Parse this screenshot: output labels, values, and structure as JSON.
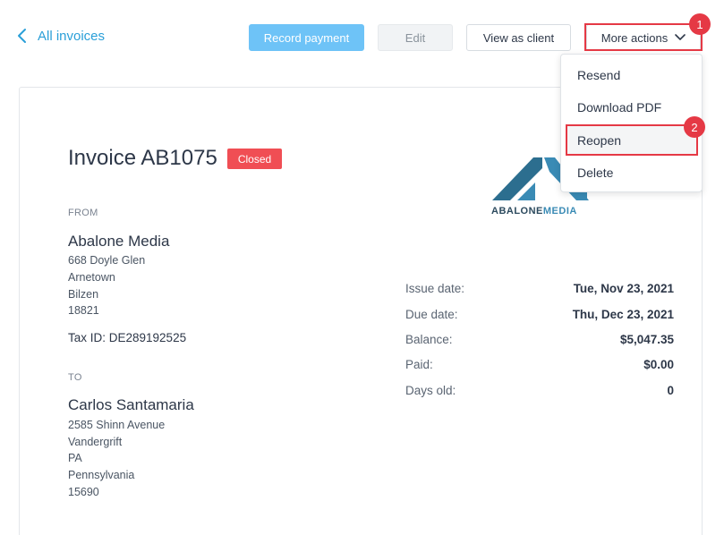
{
  "nav": {
    "back_label": "All invoices"
  },
  "toolbar": {
    "record_payment_label": "Record payment",
    "edit_label": "Edit",
    "view_as_client_label": "View as client",
    "more_actions_label": "More actions"
  },
  "annotations": {
    "badge_1": "1",
    "badge_2": "2"
  },
  "dropdown": {
    "items": [
      {
        "label": "Resend"
      },
      {
        "label": "Download PDF"
      },
      {
        "label": "Reopen"
      },
      {
        "label": "Delete"
      }
    ]
  },
  "invoice": {
    "title": "Invoice AB1075",
    "status": "Closed",
    "logo": {
      "part1": "ABALONE",
      "part2": "MEDIA"
    },
    "from": {
      "label": "FROM",
      "name": "Abalone Media",
      "address": [
        "668 Doyle Glen",
        "Arnetown",
        "Bilzen",
        "18821"
      ],
      "tax_id": "Tax ID: DE289192525"
    },
    "to": {
      "label": "TO",
      "name": "Carlos Santamaria",
      "address": [
        "2585 Shinn Avenue",
        "Vandergrift",
        "PA",
        "Pennsylvania",
        "15690"
      ]
    },
    "details": [
      {
        "label": "Issue date:",
        "value": "Tue, Nov 23, 2021"
      },
      {
        "label": "Due date:",
        "value": "Thu, Dec 23, 2021"
      },
      {
        "label": "Balance:",
        "value": "$5,047.35"
      },
      {
        "label": "Paid:",
        "value": "$0.00"
      },
      {
        "label": "Days old:",
        "value": "0"
      }
    ]
  },
  "colors": {
    "accent": "#2a9fd8",
    "primary_button": "#6ec3f7",
    "status_closed": "#f04e54",
    "annotation_red": "#e53945"
  },
  "icons": {
    "back": "chevron-left-icon",
    "more": "chevron-down-icon"
  }
}
